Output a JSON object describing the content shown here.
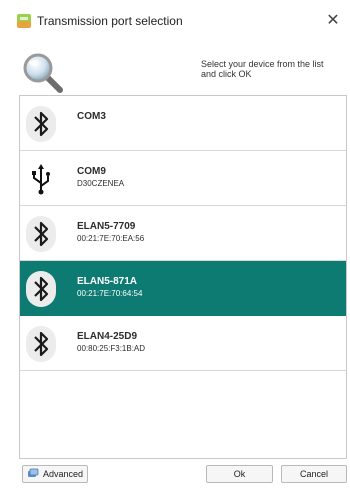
{
  "window": {
    "title": "Transmission port selection",
    "close_glyph": "✕",
    "icon": "app-icon"
  },
  "header": {
    "icon": "magnifier-icon",
    "instruction": "Select your device from the list and click OK"
  },
  "devices": [
    {
      "name": "COM3",
      "detail": "",
      "icon": "bluetooth-icon",
      "selected": false
    },
    {
      "name": "COM9",
      "detail": "D30CZENEA",
      "icon": "usb-icon",
      "selected": false
    },
    {
      "name": "ELAN5-7709",
      "detail": "00:21:7E:70:EA:56",
      "icon": "bluetooth-icon",
      "selected": false
    },
    {
      "name": "ELAN5-871A",
      "detail": "00:21:7E:70:64:54",
      "icon": "bluetooth-icon",
      "selected": true
    },
    {
      "name": "ELAN4-25D9",
      "detail": "00:80:25:F3:1B:AD",
      "icon": "bluetooth-icon",
      "selected": false
    }
  ],
  "buttons": {
    "advanced": "Advanced",
    "ok": "Ok",
    "cancel": "Cancel"
  },
  "colors": {
    "selection": "#0e7b73"
  }
}
